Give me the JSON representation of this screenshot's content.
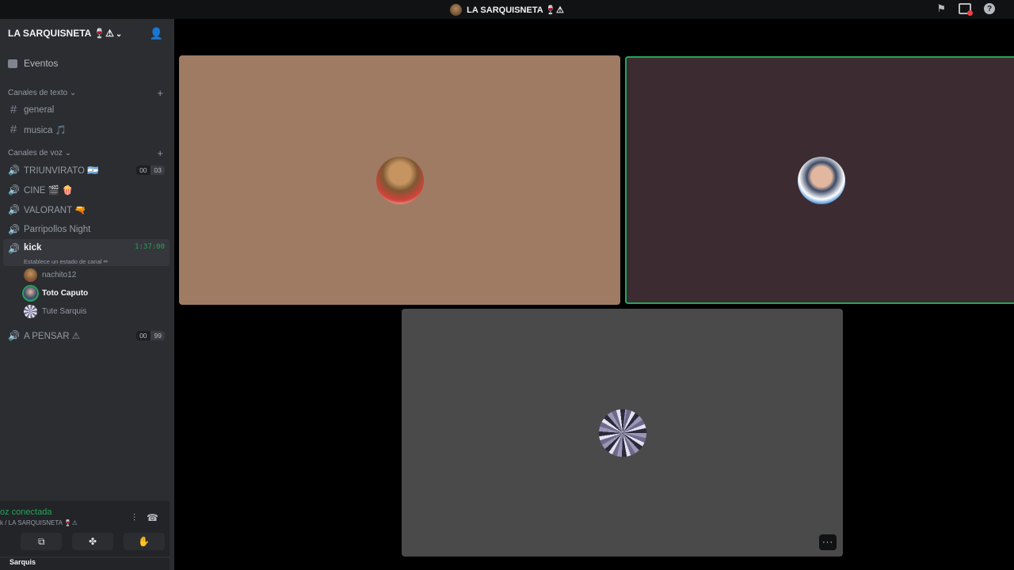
{
  "topbar": {
    "server_title": "LA SARQUISNETA 🍷⚠"
  },
  "sidebar": {
    "server_name": "LA SARQUISNETA 🍷⚠",
    "events_label": "Eventos",
    "text_category": "Canales de texto",
    "text_channels": [
      {
        "label": "general"
      },
      {
        "label": "musica 🎵"
      }
    ],
    "voice_category": "Canales de voz",
    "voice_channels": [
      {
        "label": "TRIUNVIRATO 🇦🇷",
        "count": "00",
        "limit": "03"
      },
      {
        "label": "CINE 🎬 🍿"
      },
      {
        "label": "VALORANT 🔫"
      },
      {
        "label": "Parripollos Night"
      }
    ],
    "active_channel": {
      "label": "kick",
      "time": "1:37:00",
      "status_placeholder": "Establece un estado de canal ✏",
      "users": [
        {
          "name": "nachito12"
        },
        {
          "name": "Toto Caputo"
        },
        {
          "name": "Tute Sarquis"
        }
      ]
    },
    "last_channel": {
      "label": "A PENSAR ⚠",
      "count": "00",
      "limit": "99"
    }
  },
  "voice_panel": {
    "status": "oz conectada",
    "location": "k / LA SARQUISNETA 🍷⚠",
    "user_partial": "Sarquis"
  },
  "stage": {
    "more_label": "···"
  },
  "colors": {
    "accent_green": "#23a55a",
    "sidebar_bg": "#2b2d31",
    "tile1_bg": "#9f7b63",
    "tile2_bg": "#3c2b31",
    "tile3_bg": "#4b4a4b"
  }
}
